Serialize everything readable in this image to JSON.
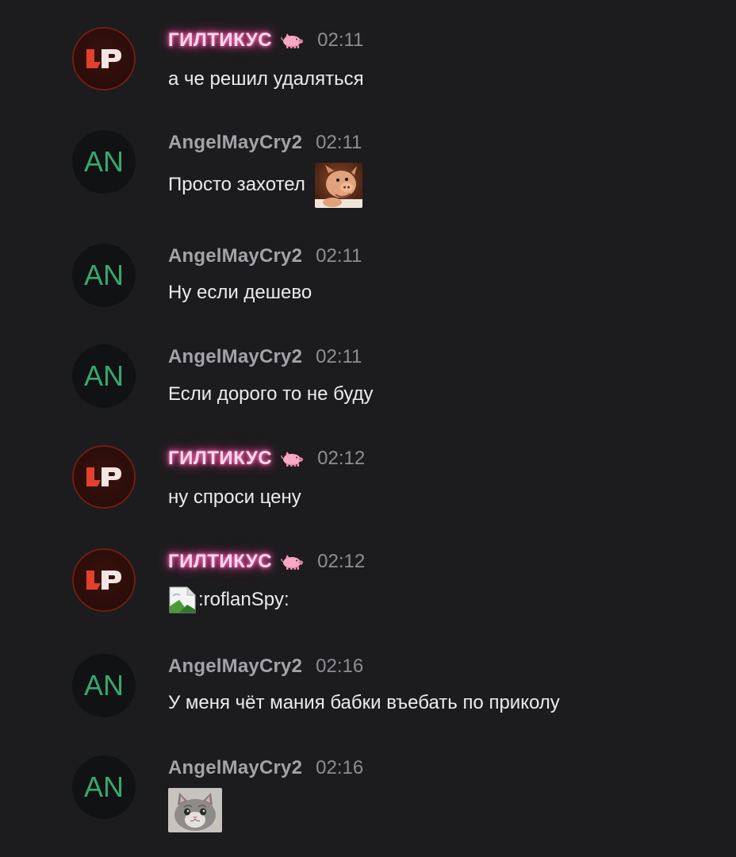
{
  "messages": [
    {
      "user": "ГИЛТИКУС",
      "time": "02:11",
      "text": "а че решил удаляться"
    },
    {
      "user": "AngelMayCry2",
      "time": "02:11",
      "text": "Просто захотел"
    },
    {
      "user": "AngelMayCry2",
      "time": "02:11",
      "text": "Ну если дешево"
    },
    {
      "user": "AngelMayCry2",
      "time": "02:11",
      "text": "Если дорого то не буду"
    },
    {
      "user": "ГИЛТИКУС",
      "time": "02:12",
      "text": "ну спроси цену"
    },
    {
      "user": "ГИЛТИКУС",
      "time": "02:12",
      "text": ":roflanSpy:"
    },
    {
      "user": "AngelMayCry2",
      "time": "02:16",
      "text": "У меня чёт мания бабки въебать по приколу"
    },
    {
      "user": "AngelMayCry2",
      "time": "02:16",
      "text": ""
    }
  ],
  "avatars": {
    "an_initials": "AN"
  },
  "icons": {
    "badge": "pig-icon",
    "broken_image": "broken-image-icon",
    "pig_sticker": "pig-sticker",
    "kitten_sticker": "kitten-sticker"
  },
  "colors": {
    "background": "#1c1c1e",
    "username": "#a3a3a8",
    "username_glow": "#ff4fa6",
    "time": "#8e8e93",
    "text": "#ececef",
    "an_avatar_text": "#37a86f",
    "lp_avatar_red": "#e2412c"
  }
}
